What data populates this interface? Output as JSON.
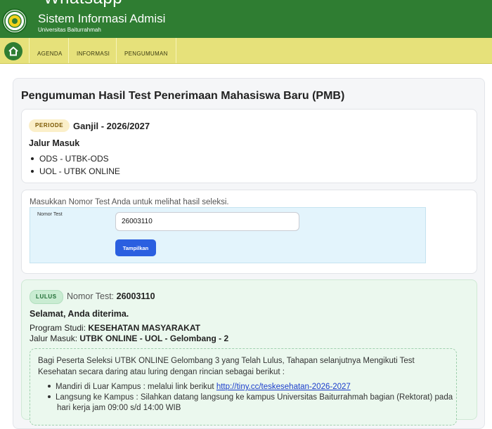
{
  "browser": {
    "partial_title": "Whatsapp"
  },
  "header": {
    "app_title": "Sistem Informasi Admisi",
    "subtitle": "Universitas Baiturrahmah",
    "brand_color": "#2f7d32"
  },
  "nav": {
    "color": "#e6e17a",
    "home_icon": "home-icon",
    "items": [
      "AGENDA",
      "INFORMASI",
      "PENGUMUMAN"
    ]
  },
  "page": {
    "title": "Pengumuman Hasil Test Penerimaan Mahasiswa Baru (PMB)"
  },
  "periode": {
    "badge": "PERIODE",
    "value": "Ganjil - 2026/2027",
    "jalur_title": "Jalur Masuk",
    "jalur": [
      "ODS - UTBK-ODS",
      "UOL - UTBK ONLINE"
    ]
  },
  "search": {
    "hint": "Masukkan Nomor Test Anda untuk melihat hasil seleksi.",
    "label": "Nomor Test",
    "value": "26003110",
    "button": "Tampilkan"
  },
  "result": {
    "badge": "LULUS",
    "nomor_label": "Nomor Test:",
    "nomor_value": "26003110",
    "selamat": "Selamat, Anda diterima.",
    "prodi_label": "Program Studi:",
    "prodi_value": "KESEHATAN MASYARAKAT",
    "jalur_label": "Jalur Masuk:",
    "jalur_value": "UTBK ONLINE - UOL - Gelombang - 2",
    "notice_text": "Bagi Peserta Seleksi UTBK ONLINE Gelombang 3 yang Telah Lulus, Tahapan selanjutnya Mengikuti Test Kesehatan secara daring atau luring dengan rincian sebagai berikut :",
    "bullet1_text": "Mandiri di Luar Kampus : melalui link berikut",
    "bullet1_link": "http://tiny.cc/teskesehatan-2026-2027",
    "bullet2_line1": "Langsung ke Kampus : Silahkan datang langsung ke kampus Universitas Baiturrahmah bagian (Rektorat) pada",
    "bullet2_line2": "hari kerja jam 09:00 s/d 14:00 WIB"
  }
}
